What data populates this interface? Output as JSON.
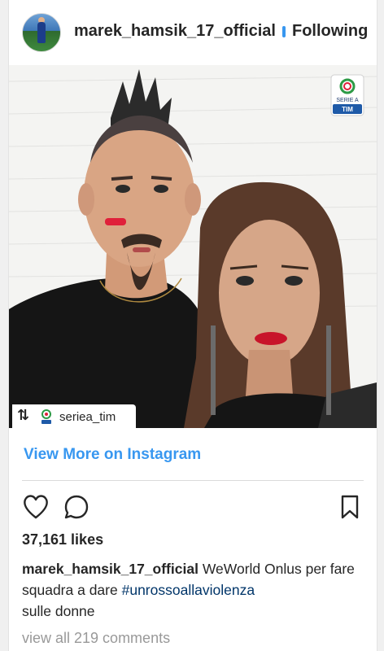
{
  "post": {
    "username": "marek_hamsik_17_official",
    "follow_label": "Following",
    "repost_account": "seriea_tim",
    "badge_line1": "SERIE A",
    "badge_line2": "TIM",
    "view_more": "View More on Instagram",
    "likes": "37,161 likes",
    "caption_user": "marek_hamsik_17_official",
    "caption_text": "WeWorld Onlus per fare squadra a dare",
    "hashtag": "#unrossoallaviolenza",
    "caption_end": "sulle donne",
    "comments": "view all 219 comments"
  },
  "icons": {
    "like": "heart-icon",
    "comment": "comment-bubble-icon",
    "save": "bookmark-icon",
    "repost": "repost-icon"
  },
  "colors": {
    "link_blue": "#3897f0",
    "hashtag_blue": "#003569",
    "text": "#262626",
    "muted": "#999999"
  }
}
